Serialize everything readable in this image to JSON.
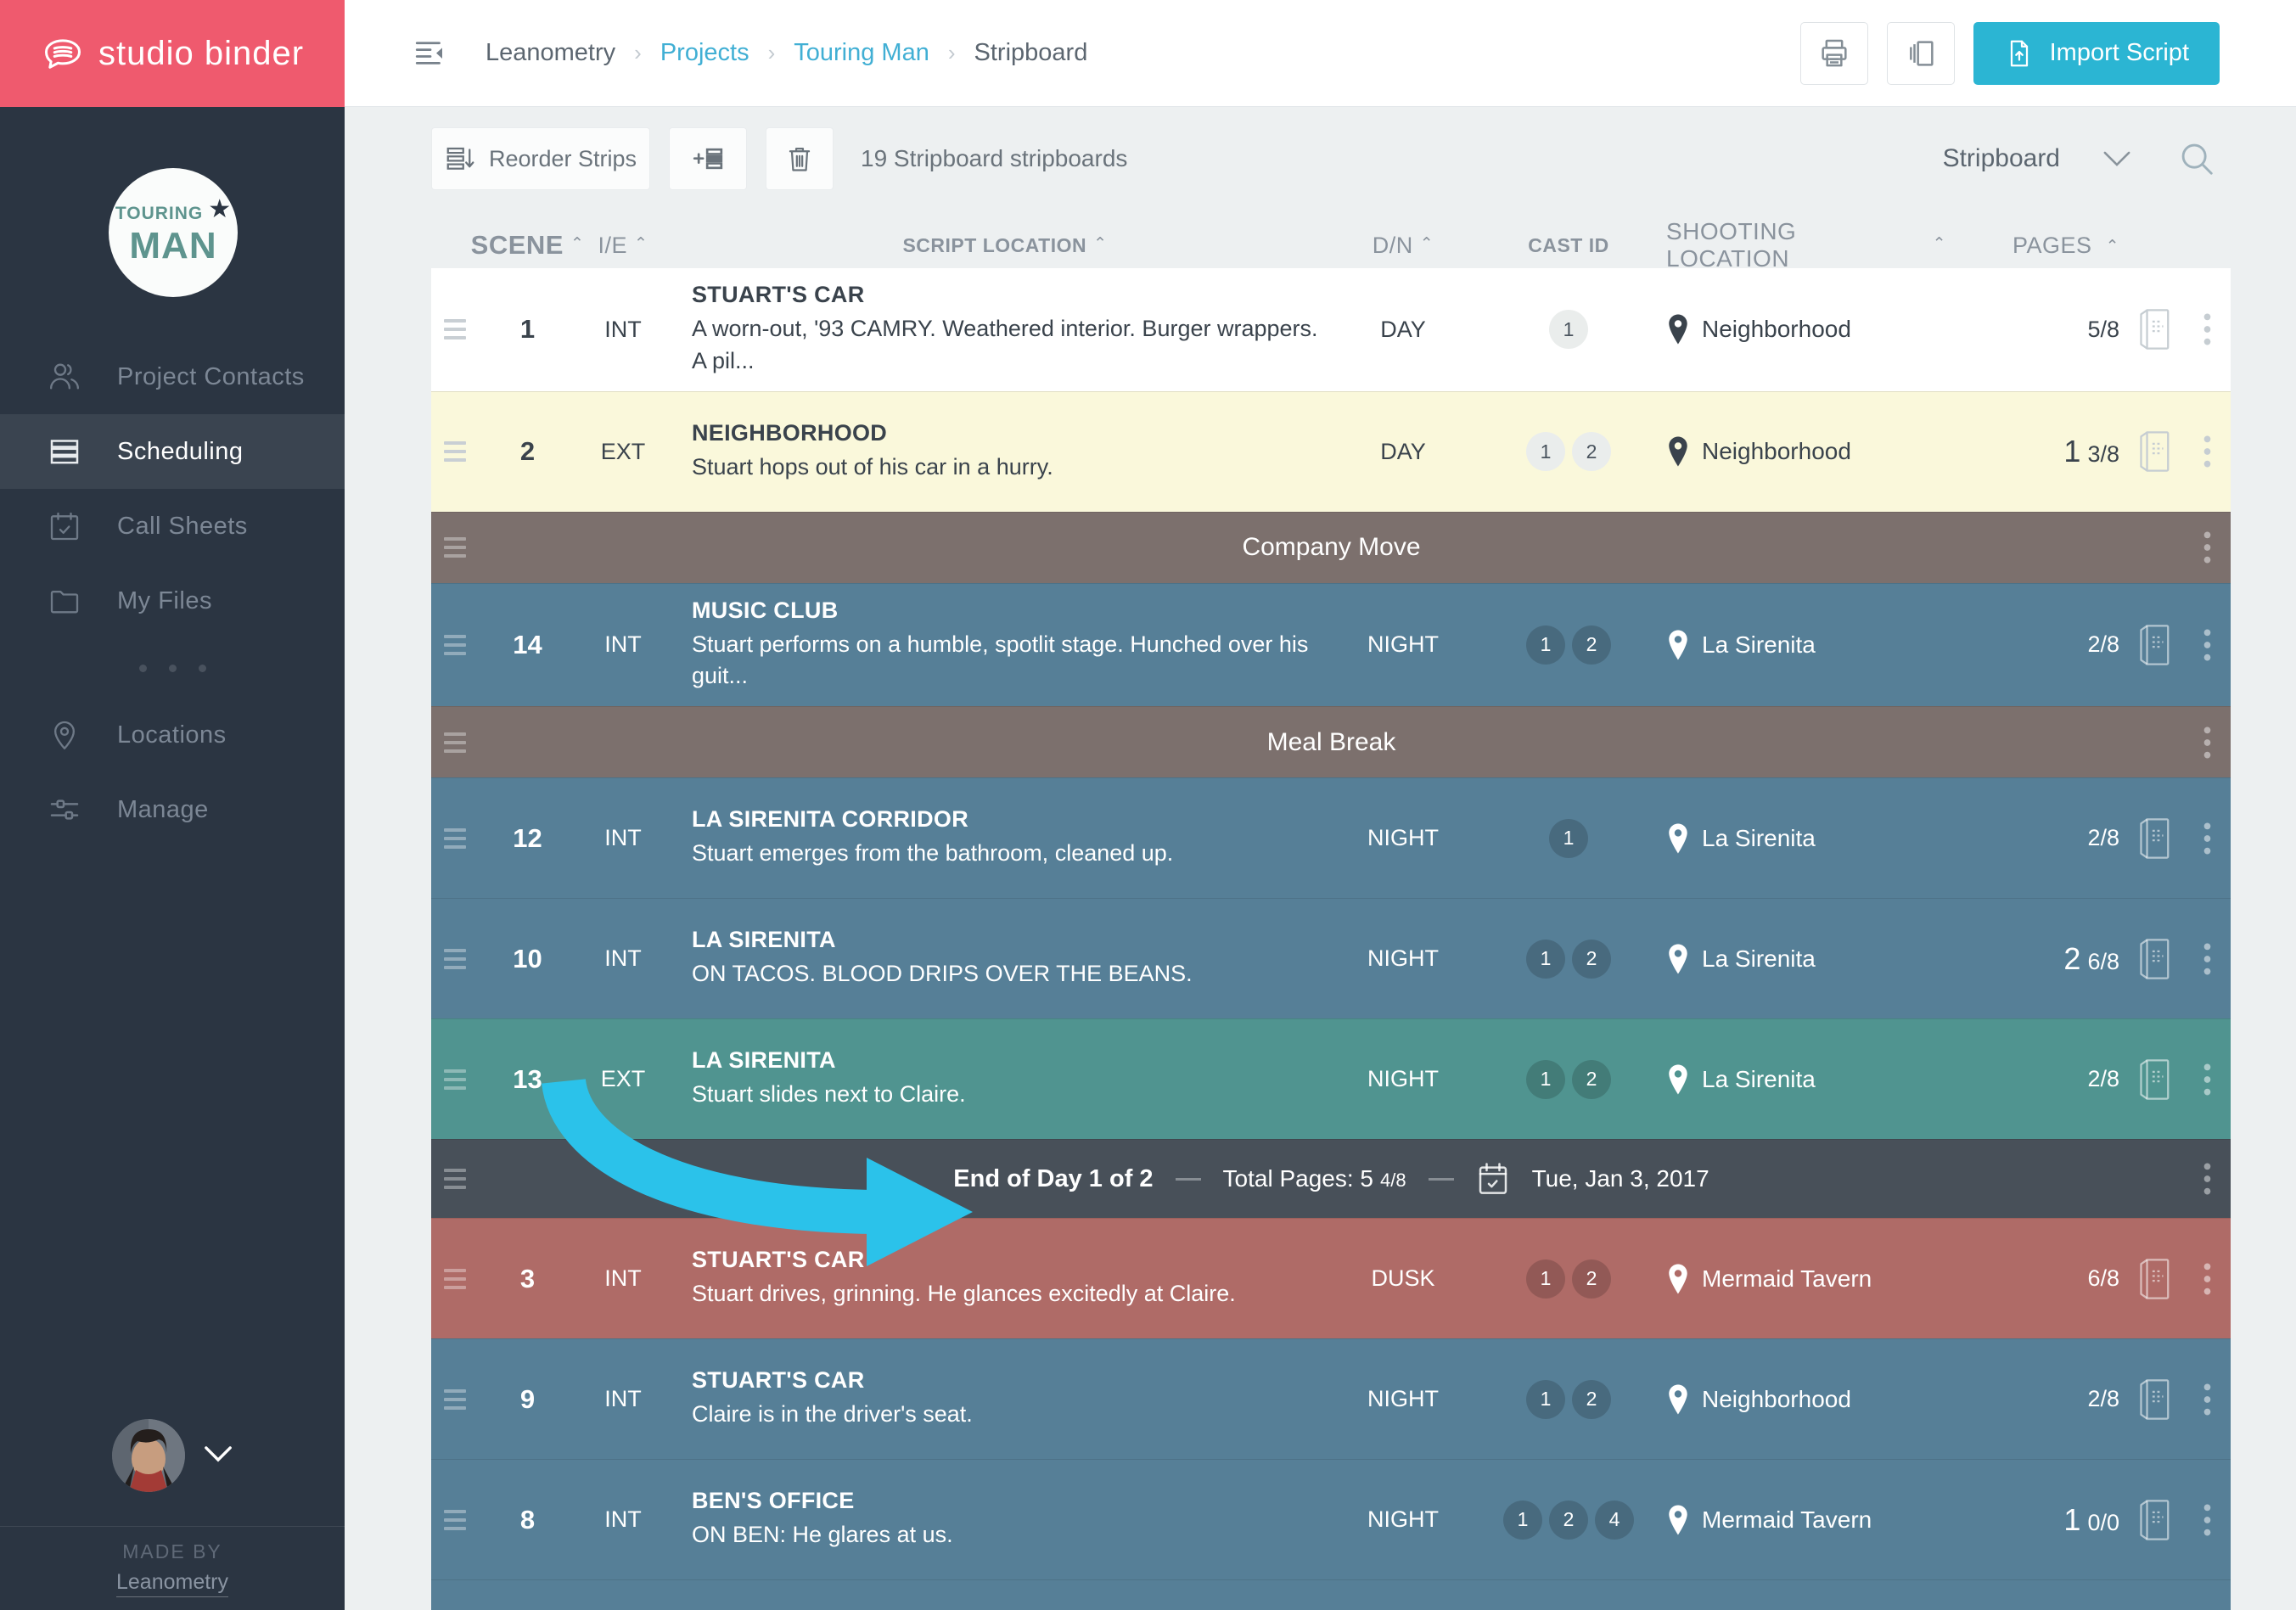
{
  "brand": {
    "logo_text": "studio binder"
  },
  "topbar": {
    "breadcrumb": [
      {
        "label": "Leanometry",
        "link": false
      },
      {
        "label": "Projects",
        "link": true
      },
      {
        "label": "Touring Man",
        "link": true
      },
      {
        "label": "Stripboard",
        "link": false
      }
    ],
    "actions": {
      "import_label": "Import Script"
    }
  },
  "sidebar": {
    "project_logo": {
      "top": "TOURING",
      "bottom": "MAN"
    },
    "items": [
      {
        "label": "Project Contacts",
        "icon": "people-icon",
        "active": false
      },
      {
        "label": "Scheduling",
        "icon": "strips-icon",
        "active": true
      },
      {
        "label": "Call Sheets",
        "icon": "calendar-check-icon",
        "active": false
      },
      {
        "label": "My Files",
        "icon": "folder-icon",
        "active": false
      },
      {
        "label": "Locations",
        "icon": "map-pin-icon",
        "active": false
      },
      {
        "label": "Manage",
        "icon": "sliders-icon",
        "active": false
      }
    ],
    "made_by_label": "MADE BY",
    "made_by_link": "Leanometry"
  },
  "toolbar": {
    "reorder_label": "Reorder Strips",
    "count_text": "19 Stripboard stripboards",
    "view_label": "Stripboard"
  },
  "board": {
    "columns": [
      {
        "label": "SCENE",
        "sortable": true
      },
      {
        "label": "I/E",
        "sortable": true
      },
      {
        "label": "SCRIPT LOCATION",
        "sortable": true
      },
      {
        "label": "D/N",
        "sortable": true
      },
      {
        "label": "CAST ID",
        "sortable": false
      },
      {
        "label": "SHOOTING LOCATION",
        "sortable": true
      },
      {
        "label": "PAGES",
        "sortable": true
      }
    ],
    "strips": [
      {
        "type": "scene",
        "color": "white",
        "scene": "1",
        "ie": "INT",
        "title": "STUART'S CAR",
        "description": "A worn-out, '93 CAMRY. Weathered interior. Burger wrappers. A pil...",
        "dn": "DAY",
        "cast": [
          "1"
        ],
        "location": "Neighborhood",
        "pages_whole": "",
        "pages_fraction": "5/8"
      },
      {
        "type": "scene",
        "color": "yellow",
        "scene": "2",
        "ie": "EXT",
        "title": "NEIGHBORHOOD",
        "description": "Stuart hops out of his car in a hurry.",
        "dn": "DAY",
        "cast": [
          "1",
          "2"
        ],
        "location": "Neighborhood",
        "pages_whole": "1",
        "pages_fraction": "3/8"
      },
      {
        "type": "banner",
        "label": "Company Move"
      },
      {
        "type": "scene",
        "color": "blue",
        "scene": "14",
        "ie": "INT",
        "title": "MUSIC CLUB",
        "description": "Stuart performs on a humble, spotlit stage. Hunched over his guit...",
        "dn": "NIGHT",
        "cast": [
          "1",
          "2"
        ],
        "location": "La Sirenita",
        "pages_whole": "",
        "pages_fraction": "2/8"
      },
      {
        "type": "banner",
        "label": "Meal Break"
      },
      {
        "type": "scene",
        "color": "blue",
        "scene": "12",
        "ie": "INT",
        "title": "LA SIRENITA CORRIDOR",
        "description": "Stuart emerges from the bathroom, cleaned up.",
        "dn": "NIGHT",
        "cast": [
          "1"
        ],
        "location": "La Sirenita",
        "pages_whole": "",
        "pages_fraction": "2/8"
      },
      {
        "type": "scene",
        "color": "blue",
        "scene": "10",
        "ie": "INT",
        "title": "LA SIRENITA",
        "description": "ON TACOS. BLOOD DRIPS OVER THE BEANS.",
        "dn": "NIGHT",
        "cast": [
          "1",
          "2"
        ],
        "location": "La Sirenita",
        "pages_whole": "2",
        "pages_fraction": "6/8"
      },
      {
        "type": "scene",
        "color": "green",
        "scene": "13",
        "ie": "EXT",
        "title": "LA SIRENITA",
        "description": "Stuart slides next to Claire.",
        "dn": "NIGHT",
        "cast": [
          "1",
          "2"
        ],
        "location": "La Sirenita",
        "pages_whole": "",
        "pages_fraction": "2/8"
      },
      {
        "type": "day",
        "title": "End of Day 1 of 2",
        "total_label": "Total Pages: 5",
        "total_fraction": "4/8",
        "date": "Tue, Jan 3, 2017"
      },
      {
        "type": "scene",
        "color": "red",
        "scene": "3",
        "ie": "INT",
        "title": "STUART'S CAR",
        "description": "Stuart drives, grinning. He glances excitedly at Claire.",
        "dn": "DUSK",
        "cast": [
          "1",
          "2"
        ],
        "location": "Mermaid Tavern",
        "pages_whole": "",
        "pages_fraction": "6/8"
      },
      {
        "type": "scene",
        "color": "blue",
        "scene": "9",
        "ie": "INT",
        "title": "STUART'S CAR",
        "description": "Claire is in the driver's seat.",
        "dn": "NIGHT",
        "cast": [
          "1",
          "2"
        ],
        "location": "Neighborhood",
        "pages_whole": "",
        "pages_fraction": "2/8"
      },
      {
        "type": "scene",
        "color": "blue",
        "scene": "8",
        "ie": "INT",
        "title": "BEN'S OFFICE",
        "description": "ON BEN: He glares at us.",
        "dn": "NIGHT",
        "cast": [
          "1",
          "2",
          "4"
        ],
        "location": "Mermaid Tavern",
        "pages_whole": "1",
        "pages_fraction": "0/0"
      },
      {
        "type": "cut",
        "color": "blue"
      }
    ]
  },
  "colors": {
    "brand_pink": "#EF5A6E",
    "accent_cyan": "#2BB5D3",
    "arrow_cyan": "#2BC2EA",
    "sidebar_bg": "#2B3542",
    "strip_blue": "#567F97",
    "strip_green": "#509490",
    "strip_red": "#AF6B67",
    "strip_yellow": "#FAF8DB",
    "strip_banner": "#7C706D",
    "strip_day": "#485059"
  }
}
